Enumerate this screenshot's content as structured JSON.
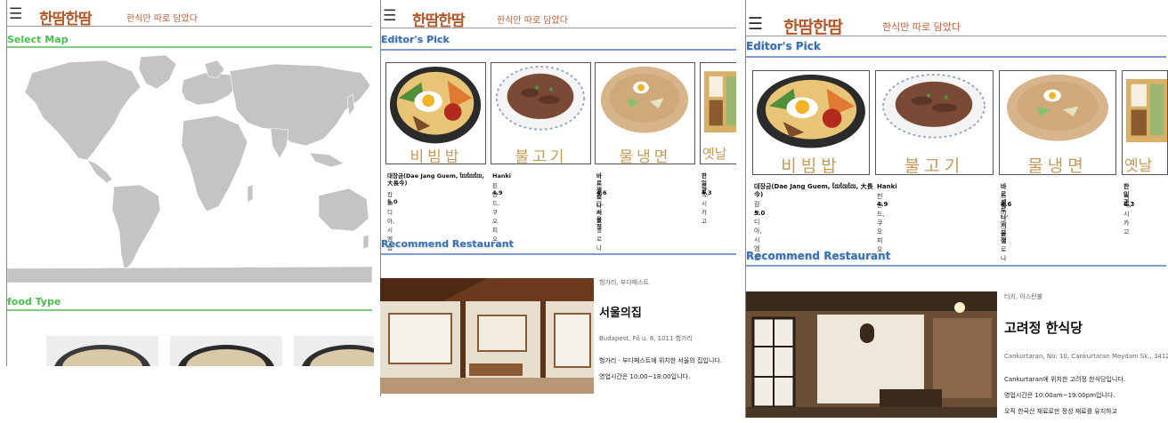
{
  "brand": {
    "logo": "한땀한땀",
    "slogan": "한식만 따로 담았다",
    "accent": "#b4582a"
  },
  "icons": {
    "menu": "hamburger-menu-icon"
  },
  "map_view": {
    "select_map_title": "Select Map",
    "food_type_title": "food Type",
    "accent": "#49c04e"
  },
  "editors_pick": {
    "title": "Editor's Pick",
    "cards": [
      {
        "dish": "비빔밥",
        "name": "대장금(Dae Jang Guem, ដែរដែរដែរ, 大長今)",
        "location": "캄보디아, 시엠립",
        "rating": "5.0"
      },
      {
        "dish": "불고기",
        "name": "Hanki",
        "location": "핀란드, 쿠오피오",
        "rating": "4.9"
      },
      {
        "dish": "물냉면",
        "name": "바르셀로나 서울정",
        "location": "스페인, 바르셀로나",
        "rating": "4.6"
      },
      {
        "dish": "옛날",
        "name": "한일관",
        "location": "미국, 시카고",
        "rating": "4.3"
      }
    ]
  },
  "recommend": {
    "title": "Recommend Restaurant",
    "restaurants": [
      {
        "region": "헝가리, 부다페스트",
        "name": "서울의집",
        "address": "Budapest, Fő u. 8, 1011 헝가리",
        "desc1": "헝가리 · 부다페스트에 위치한 서울의 집입니다.",
        "desc2": "영업시간은 10:00~18:00입니다."
      },
      {
        "region": "터키, 이스탄불",
        "name": "고려정 한식당",
        "address": "Cankurtaran, No: 10, Cankurtaran Meydanı Sk., 34122",
        "desc1": "Cankurtaran에 위치한 고려정 한식당입니다.",
        "desc2": "영업시간은 10:00am~19:00pm입니다.",
        "desc3": "오직 한국산 재료로만 정성 재료를 유지하고"
      }
    ]
  }
}
